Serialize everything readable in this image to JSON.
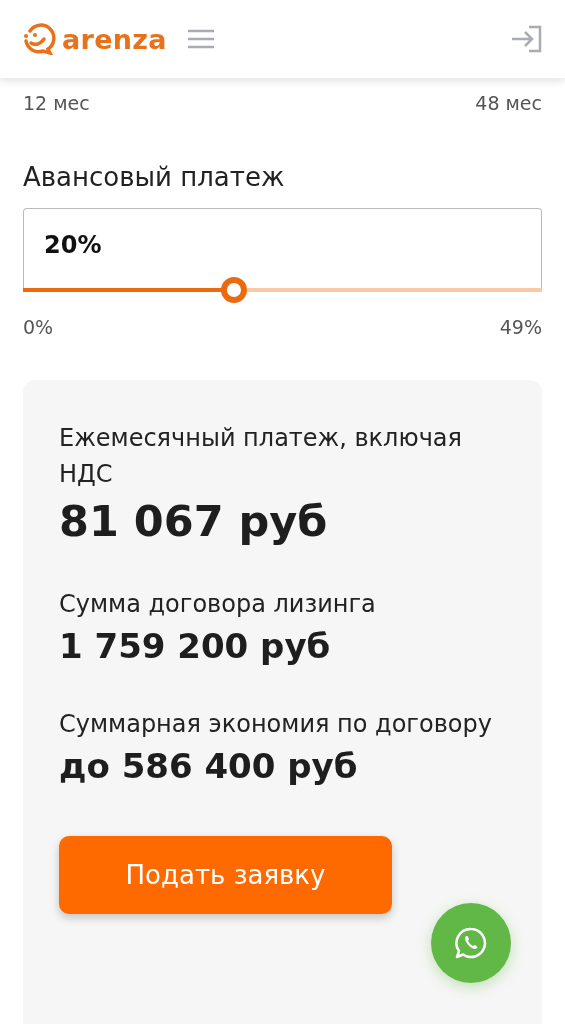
{
  "header": {
    "logo_text": "arenza"
  },
  "term": {
    "min_label": "12 мес",
    "max_label": "48 мес"
  },
  "advance": {
    "title": "Авансовый платеж",
    "value": "20%",
    "level": 0.407,
    "min_label": "0%",
    "max_label": "49%"
  },
  "summary": {
    "items": [
      {
        "label": "Ежемесячный платеж, включая НДС",
        "value": "81 067 руб",
        "kind": "large"
      },
      {
        "label": "Сумма договора лизинга",
        "value": "1 759 200 руб",
        "kind": "medium"
      },
      {
        "label": "Суммарная экономия по договору",
        "value": "до 586 400 руб",
        "kind": "medium"
      }
    ],
    "button": "Подать заявку"
  }
}
